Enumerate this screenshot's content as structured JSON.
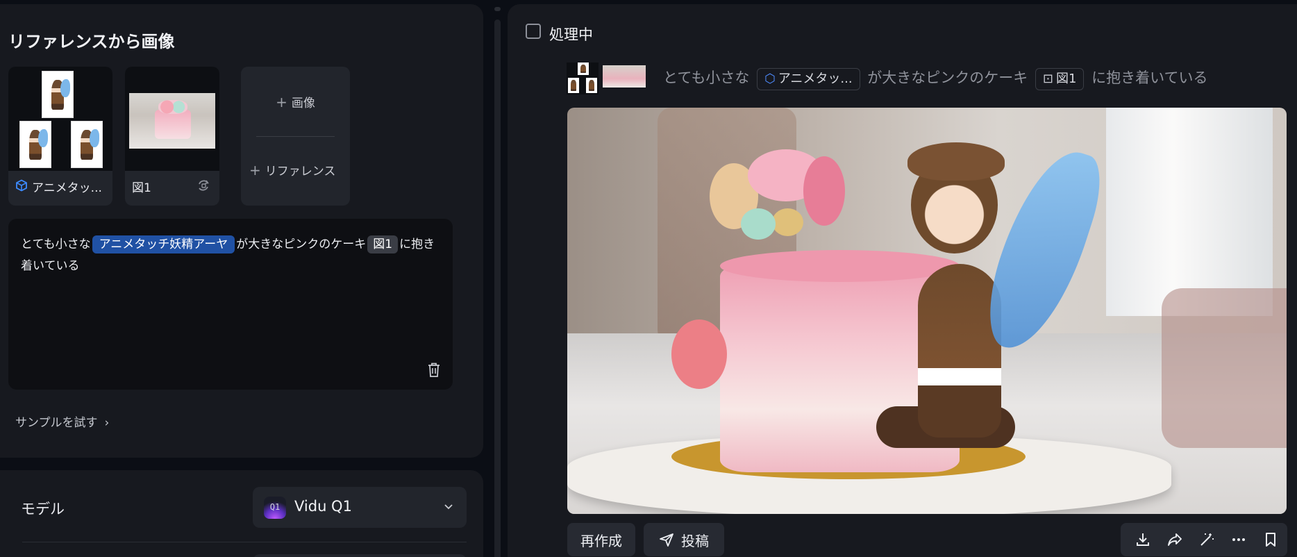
{
  "left_panel": {
    "title": "リファレンスから画像",
    "references": [
      {
        "label": "アニメタッ...",
        "icon": "cube-icon"
      },
      {
        "label": "図1",
        "icon": "swap-icon"
      }
    ],
    "add_image_label": "画像",
    "add_reference_label": "リファレンス",
    "prompt": {
      "before": "とても小さな",
      "chip1": "アニメタッチ妖精アーヤ",
      "middle": "が大きなピンクのケーキ",
      "chip2": "図1",
      "after": "に抱き着いている"
    },
    "sample_link": "サンプルを試す",
    "model_label": "モデル",
    "model_icon_text": "Q1",
    "model_value": "Vidu Q1"
  },
  "right_panel": {
    "status_label": "処理中",
    "prompt": {
      "before": "とても小さな",
      "chip1": "アニメタッ...",
      "middle": "が大きなピンクのケーキ",
      "chip2": "図1",
      "after": "に抱き着いている"
    },
    "recreate_label": "再作成",
    "post_label": "投稿",
    "tools": [
      "download-icon",
      "share-icon",
      "magic-wand-icon",
      "more-icon",
      "bookmark-icon"
    ]
  },
  "colors": {
    "accent_chip": "#2051a4",
    "panel_bg": "#17191f",
    "page_bg": "#0b0e15"
  }
}
